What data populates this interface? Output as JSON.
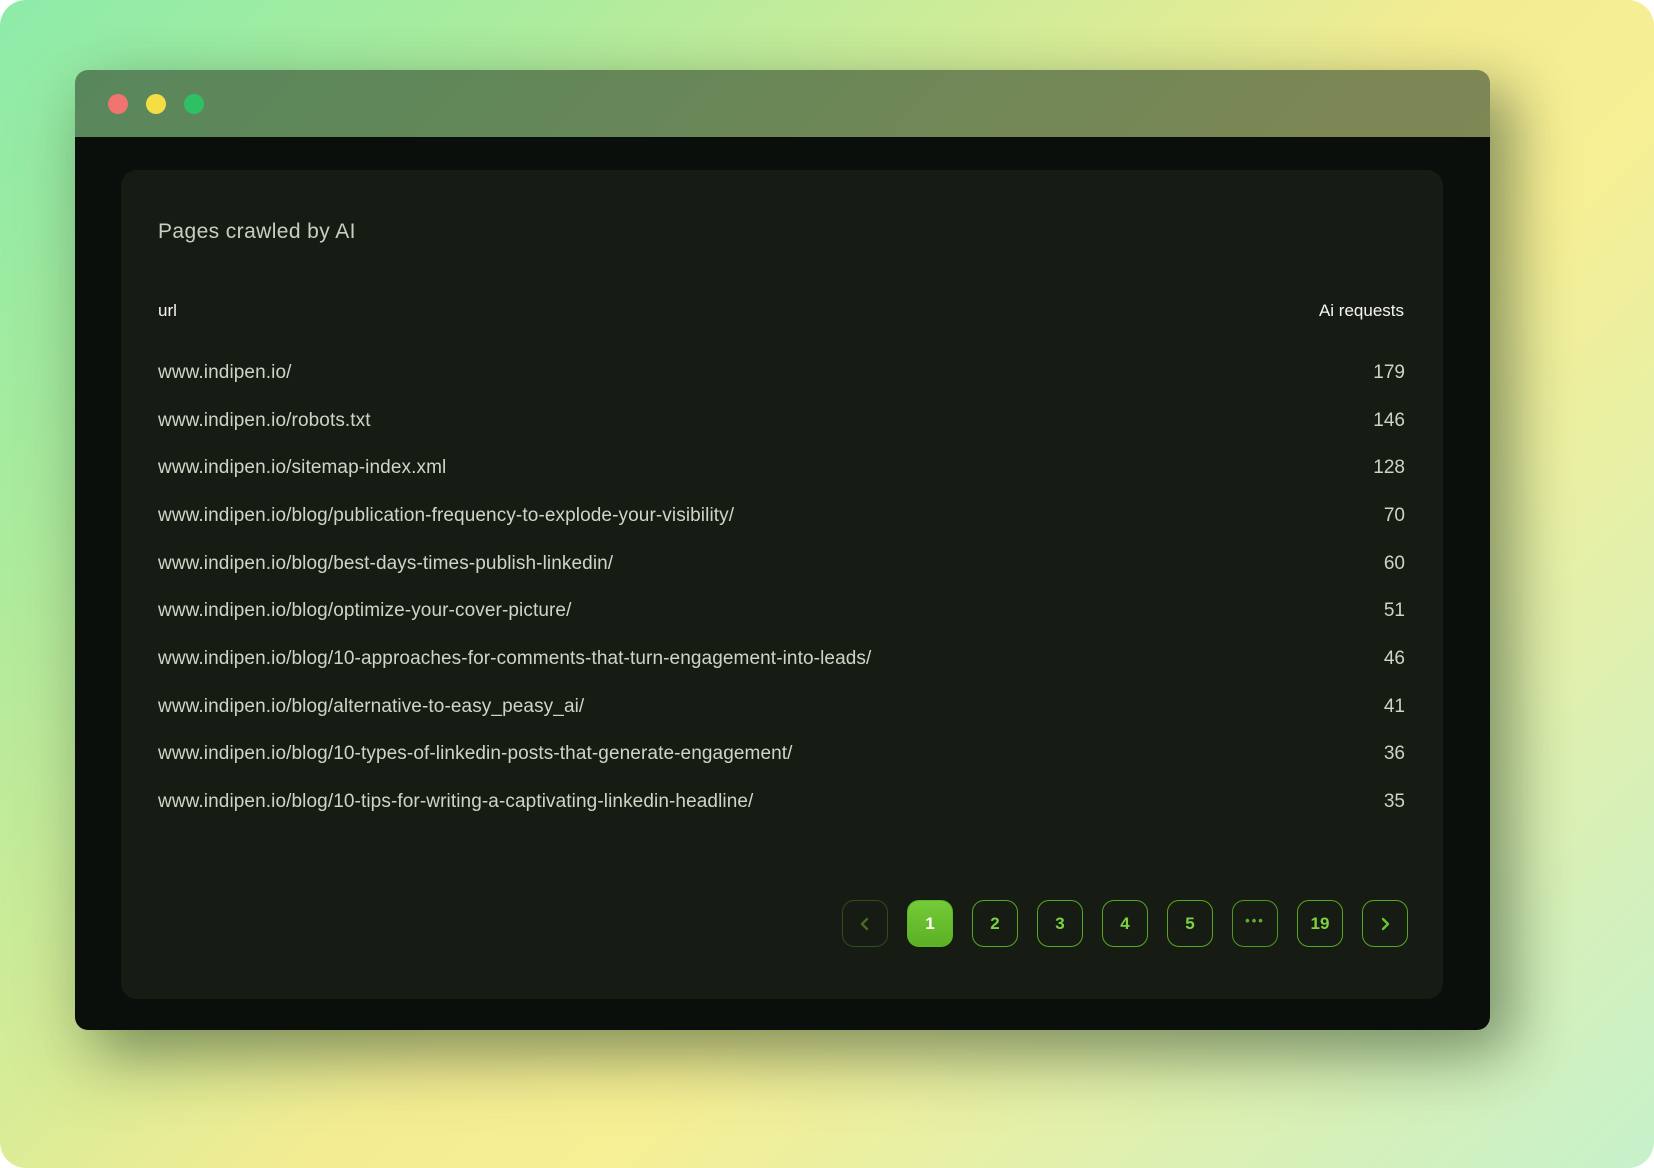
{
  "window": {
    "titlebar": {
      "buttons": [
        "close",
        "minimize",
        "zoom"
      ]
    }
  },
  "card": {
    "title": "Pages crawled by AI",
    "table": {
      "columns": [
        "url",
        "Ai requests"
      ],
      "rows": [
        {
          "url": "www.indipen.io/",
          "requests": "179"
        },
        {
          "url": "www.indipen.io/robots.txt",
          "requests": "146"
        },
        {
          "url": "www.indipen.io/sitemap-index.xml",
          "requests": "128"
        },
        {
          "url": "www.indipen.io/blog/publication-frequency-to-explode-your-visibility/",
          "requests": "70"
        },
        {
          "url": "www.indipen.io/blog/best-days-times-publish-linkedin/",
          "requests": "60"
        },
        {
          "url": "www.indipen.io/blog/optimize-your-cover-picture/",
          "requests": "51"
        },
        {
          "url": "www.indipen.io/blog/10-approaches-for-comments-that-turn-engagement-into-leads/",
          "requests": "46"
        },
        {
          "url": "www.indipen.io/blog/alternative-to-easy_peasy_ai/",
          "requests": "41"
        },
        {
          "url": "www.indipen.io/blog/10-types-of-linkedin-posts-that-generate-engagement/",
          "requests": "36"
        },
        {
          "url": "www.indipen.io/blog/10-tips-for-writing-a-captivating-linkedin-headline/",
          "requests": "35"
        }
      ]
    },
    "pagination": {
      "pages": [
        "1",
        "2",
        "3",
        "4",
        "5",
        "•••",
        "19"
      ],
      "active_page": "1",
      "ellipsis": "•••",
      "prev_icon": "chevron-left",
      "next_icon": "chevron-right"
    }
  },
  "colors": {
    "background_gradient": [
      "#8deca9",
      "#f3ec93",
      "#c6f1cb"
    ],
    "titlebar_overlay": "rgba(52,72,46,0.62)",
    "window_body": "#0a0f0b",
    "card_background": "#161c14",
    "accent_green_border": "#58a81e",
    "accent_green_text": "#7ed23f",
    "active_page_fill": "#66bf2b",
    "row_text": "#cdd6c6",
    "header_text": "#f4f7f1",
    "traffic_red": "#f07571",
    "traffic_yellow": "#f5dd45",
    "traffic_green": "#2ec062"
  }
}
